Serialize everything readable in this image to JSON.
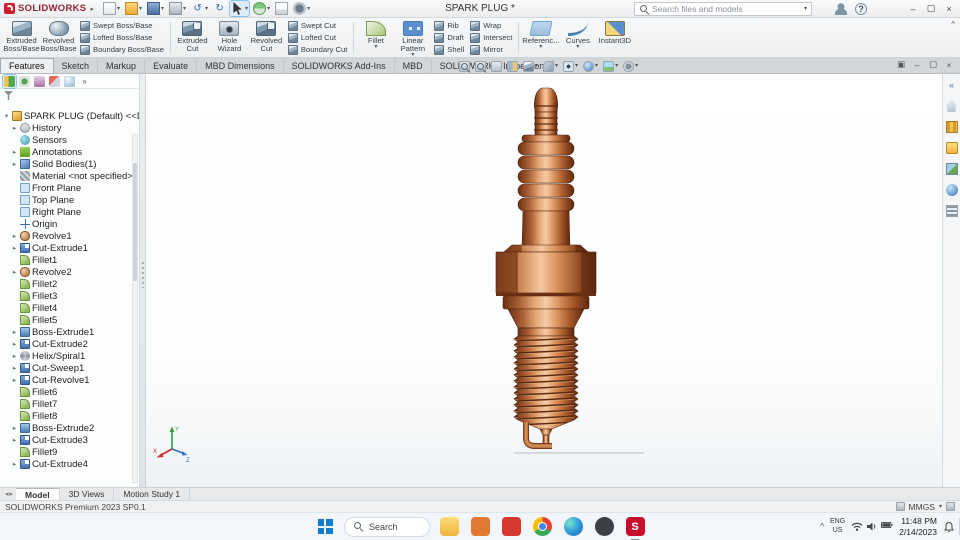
{
  "glyphs": {
    "dropdown": "▾",
    "expand": "▸",
    "expanded": "▾",
    "logo_expand": "▸",
    "ribbon_collapse": "^",
    "window_min": "–",
    "window_max": "▢",
    "window_close": "×",
    "doc_cascade": "▣",
    "doc_min": "–",
    "doc_restore": "▢",
    "doc_close": "×",
    "tab_prev": "◂",
    "tab_next": "▸",
    "tray_chevron": "^",
    "units_dropdown": "▾"
  },
  "colors": {
    "brand_red": "#d11f2f",
    "accent_blue": "#2a7fc1",
    "copper": "#c97c4c",
    "taskbar_bg": "#f2f6fb"
  },
  "titlebar": {
    "app_name": "SOLIDWORKS",
    "doc_title": "SPARK PLUG *",
    "search_placeholder": "Search files and models",
    "qat": [
      {
        "name": "new-file",
        "arrow": true
      },
      {
        "name": "open-file",
        "arrow": true
      },
      {
        "name": "save-file",
        "arrow": true
      },
      {
        "name": "print-file",
        "arrow": true
      },
      {
        "name": "undo",
        "glyph": "↺",
        "arrow": true
      },
      {
        "name": "redo",
        "glyph": "↻"
      },
      {
        "name": "select",
        "arrow": true,
        "active": true
      },
      {
        "name": "rebuild",
        "arrow": true
      },
      {
        "name": "file-properties"
      },
      {
        "name": "options",
        "arrow": true
      }
    ],
    "right_icons": [
      {
        "name": "login-user"
      },
      {
        "name": "help",
        "glyph": "?"
      }
    ]
  },
  "ribbon": {
    "groups": [
      {
        "type": "large",
        "label": "Extruded Boss/Base",
        "icon": "extrude-boss"
      },
      {
        "type": "large",
        "label": "Revolved Boss/Base",
        "icon": "revolve-boss"
      },
      {
        "type": "stack",
        "items": [
          {
            "label": "Swept Boss/Base",
            "icon": "swept-boss"
          },
          {
            "label": "Lofted Boss/Base",
            "icon": "loft-boss"
          },
          {
            "label": "Boundary Boss/Base",
            "icon": "boundary-boss"
          }
        ]
      },
      {
        "type": "sep"
      },
      {
        "type": "large",
        "label": "Extruded Cut",
        "icon": "extrude-cut"
      },
      {
        "type": "large",
        "label": "Hole Wizard",
        "icon": "hole-wizard"
      },
      {
        "type": "large",
        "label": "Revolved Cut",
        "icon": "revolve-cut"
      },
      {
        "type": "stack",
        "items": [
          {
            "label": "Swept Cut",
            "icon": "swept-cut"
          },
          {
            "label": "Lofted Cut",
            "icon": "loft-cut"
          },
          {
            "label": "Boundary Cut",
            "icon": "boundary-cut"
          }
        ]
      },
      {
        "type": "sep"
      },
      {
        "type": "large",
        "label": "Fillet",
        "icon": "fillet",
        "arrow": true
      },
      {
        "type": "large",
        "label": "Linear Pattern",
        "icon": "linear-pattern",
        "arrow": true
      },
      {
        "type": "stack",
        "items": [
          {
            "label": "Rib",
            "icon": "rib"
          },
          {
            "label": "Draft",
            "icon": "draft"
          },
          {
            "label": "Shell",
            "icon": "shell"
          }
        ]
      },
      {
        "type": "stack",
        "items": [
          {
            "label": "Wrap",
            "icon": "wrap"
          },
          {
            "label": "Intersect",
            "icon": "intersect"
          },
          {
            "label": "Mirror",
            "icon": "mirror"
          }
        ]
      },
      {
        "type": "sep"
      },
      {
        "type": "large",
        "label": "Referenc...",
        "icon": "reference-geometry",
        "arrow": true
      },
      {
        "type": "large",
        "label": "Curves",
        "icon": "curves",
        "arrow": true
      },
      {
        "type": "large",
        "label": "Instant3D",
        "icon": "instant3d"
      }
    ]
  },
  "tabs": {
    "items": [
      "Features",
      "Sketch",
      "Markup",
      "Evaluate",
      "MBD Dimensions",
      "SOLIDWORKS Add-Ins",
      "MBD",
      "SOLIDWORKS Inspection"
    ],
    "active": "Features"
  },
  "headsup": [
    {
      "name": "zoom-fit"
    },
    {
      "name": "zoom-area"
    },
    {
      "name": "previous-view"
    },
    {
      "name": "section-view"
    },
    {
      "name": "view-orientation",
      "arrow": true
    },
    {
      "name": "display-style",
      "arrow": true
    },
    {
      "name": "hide-show",
      "arrow": true
    },
    {
      "name": "edit-appearance",
      "arrow": true
    },
    {
      "name": "apply-scene",
      "arrow": true
    },
    {
      "name": "view-settings",
      "arrow": true
    }
  ],
  "manager_tabs": [
    {
      "name": "feature-mgr",
      "active": true
    },
    {
      "name": "property-mgr"
    },
    {
      "name": "config-mgr"
    },
    {
      "name": "dimxpert-mgr"
    },
    {
      "name": "display-mgr"
    },
    {
      "name": "more",
      "glyph": "»"
    }
  ],
  "tree": {
    "root": "SPARK PLUG (Default) <<Default>",
    "items": [
      {
        "label": "History",
        "icon": "history",
        "expand": true
      },
      {
        "label": "Sensors",
        "icon": "sensors"
      },
      {
        "label": "Annotations",
        "icon": "annotations",
        "expand": true
      },
      {
        "label": "Solid Bodies(1)",
        "icon": "solid-bodies",
        "expand": true
      },
      {
        "label": "Material <not specified>",
        "icon": "material"
      },
      {
        "label": "Front Plane",
        "icon": "plane"
      },
      {
        "label": "Top Plane",
        "icon": "plane"
      },
      {
        "label": "Right Plane",
        "icon": "plane"
      },
      {
        "label": "Origin",
        "icon": "origin"
      },
      {
        "label": "Revolve1",
        "icon": "revolve",
        "expand": true
      },
      {
        "label": "Cut-Extrude1",
        "icon": "cut-extrude",
        "expand": true
      },
      {
        "label": "Fillet1",
        "icon": "fillet"
      },
      {
        "label": "Revolve2",
        "icon": "revolve",
        "expand": true
      },
      {
        "label": "Fillet2",
        "icon": "fillet"
      },
      {
        "label": "Fillet3",
        "icon": "fillet"
      },
      {
        "label": "Fillet4",
        "icon": "fillet"
      },
      {
        "label": "Fillet5",
        "icon": "fillet"
      },
      {
        "label": "Boss-Extrude1",
        "icon": "boss-extrude",
        "expand": true
      },
      {
        "label": "Cut-Extrude2",
        "icon": "cut-extrude",
        "expand": true
      },
      {
        "label": "Helix/Spiral1",
        "icon": "helix",
        "expand": true
      },
      {
        "label": "Cut-Sweep1",
        "icon": "cut-sweep",
        "expand": true
      },
      {
        "label": "Cut-Revolve1",
        "icon": "cut-revolve",
        "expand": true
      },
      {
        "label": "Fillet6",
        "icon": "fillet"
      },
      {
        "label": "Fillet7",
        "icon": "fillet"
      },
      {
        "label": "Fillet8",
        "icon": "fillet"
      },
      {
        "label": "Boss-Extrude2",
        "icon": "boss-extrude",
        "expand": true
      },
      {
        "label": "Cut-Extrude3",
        "icon": "cut-extrude",
        "expand": true
      },
      {
        "label": "Fillet9",
        "icon": "fillet"
      },
      {
        "label": "Cut-Extrude4",
        "icon": "cut-extrude",
        "expand": true
      }
    ]
  },
  "viewport": {
    "triad": {
      "x": "X",
      "y": "Y",
      "z": "Z"
    }
  },
  "taskpane": [
    {
      "name": "collapse-pane",
      "glyph": "«"
    },
    {
      "name": "home",
      "glyph": ""
    },
    {
      "name": "design-library"
    },
    {
      "name": "file-explorer-pane"
    },
    {
      "name": "view-palette"
    },
    {
      "name": "appearances"
    },
    {
      "name": "custom-properties"
    }
  ],
  "bottom_tabs": {
    "items": [
      "Model",
      "3D Views",
      "Motion Study 1"
    ],
    "active": "Model"
  },
  "statusbar": {
    "left": "SOLIDWORKS Premium 2023 SP0.1",
    "units": "MMGS"
  },
  "taskbar": {
    "search_label": "Search",
    "apps": [
      {
        "name": "file-explorer"
      },
      {
        "name": "app-orange",
        "color": "#e0792f"
      },
      {
        "name": "app-red",
        "color": "#d63a2e"
      },
      {
        "name": "chrome"
      },
      {
        "name": "edge"
      },
      {
        "name": "app-dark",
        "color": "#3a4046"
      },
      {
        "name": "solidworks",
        "glyph": "S",
        "color": "#c8102e",
        "open": true
      }
    ],
    "tray": {
      "lang1": "ENG",
      "lang2": "US",
      "icons": [
        "wifi",
        "volume",
        "battery"
      ],
      "time": "11:48 PM",
      "date": "2/14/2023"
    }
  }
}
